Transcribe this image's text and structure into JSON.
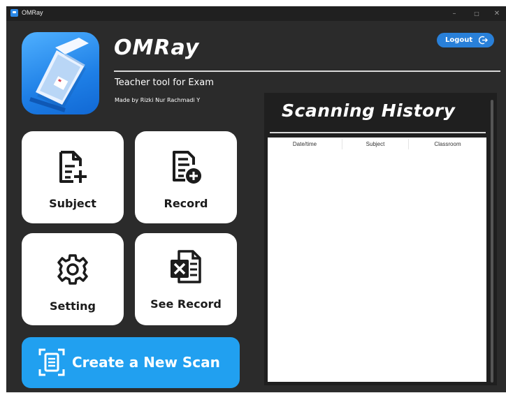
{
  "window": {
    "title": "OMRay",
    "controls": {
      "minimize": "–",
      "maximize": "□",
      "close": "✕"
    }
  },
  "header": {
    "app_name": "OMRay",
    "tagline": "Teacher tool for Exam",
    "author": "Made by Rizki Nur Rachmadi Y",
    "logout_label": "Logout"
  },
  "tiles": [
    {
      "label": "Subject",
      "icon": "document-add-icon"
    },
    {
      "label": "Record",
      "icon": "record-add-icon"
    },
    {
      "label": "Setting",
      "icon": "gear-icon"
    },
    {
      "label": "See Record",
      "icon": "excel-file-icon"
    }
  ],
  "scan_button": {
    "label": "Create a New Scan",
    "icon": "scan-document-icon"
  },
  "history": {
    "title": "Scanning History",
    "columns": [
      "Date/time",
      "Subject",
      "Classroom"
    ],
    "rows": []
  },
  "colors": {
    "window_bg": "#2b2b2b",
    "titlebar_bg": "#202020",
    "accent_blue": "#21a0f0",
    "logout_blue": "#2980d9",
    "tile_bg": "#ffffff",
    "panel_bg": "#1f1f1f"
  }
}
